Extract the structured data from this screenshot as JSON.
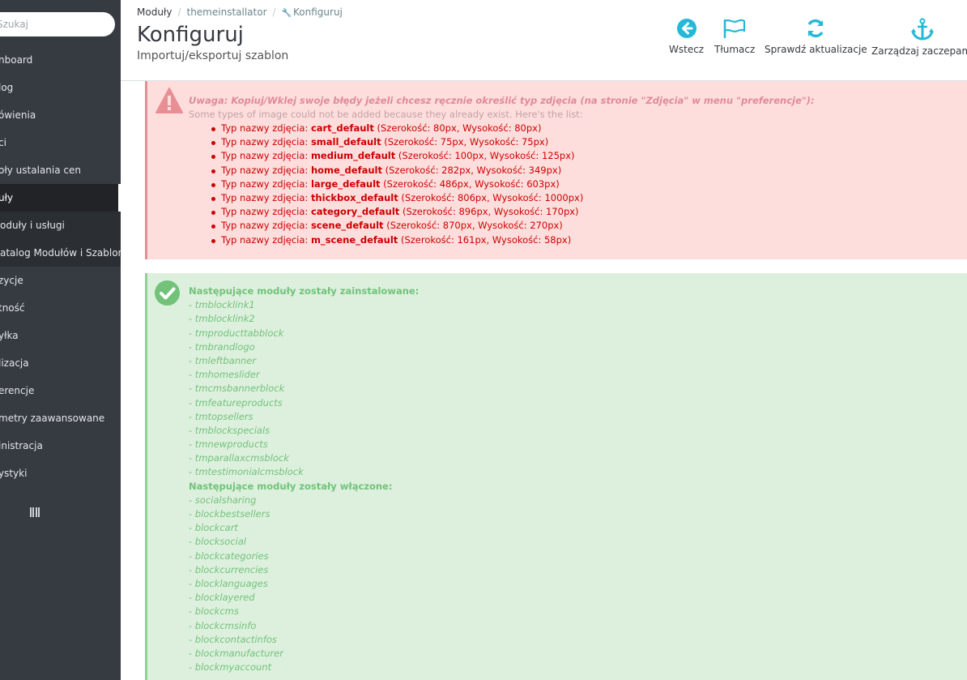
{
  "search": {
    "placeholder": "Szukaj"
  },
  "sidebar": {
    "items": [
      {
        "label": "nboard",
        "x": -2
      },
      {
        "label": "log",
        "x": -2
      },
      {
        "label": "ówienia",
        "x": -2
      },
      {
        "label": "ci",
        "x": -2
      },
      {
        "label": "oły ustalania cen",
        "x": -2
      },
      {
        "label": "uły",
        "x": -2
      },
      {
        "label": "oduły i usługi",
        "x": -2
      },
      {
        "label": "atalog Modułów i Szablon...",
        "x": -2
      },
      {
        "label": "zycje",
        "x": -2
      },
      {
        "label": "tność",
        "x": -2
      },
      {
        "label": "yłka",
        "x": -2
      },
      {
        "label": "lizacja",
        "x": -2
      },
      {
        "label": "erencje",
        "x": -2
      },
      {
        "label": "metry zaawansowane",
        "x": -2
      },
      {
        "label": "inistracja",
        "x": -2
      },
      {
        "label": "ystyki",
        "x": -2
      }
    ]
  },
  "breadcrumb": {
    "item1": "Moduły",
    "item2": "themeinstallator",
    "item3": "Konfiguruj"
  },
  "page": {
    "title": "Konfiguruj",
    "subtitle": "Importuj/eksportuj szablon"
  },
  "toolbar": {
    "back": "Wstecz",
    "translate": "Tłumacz",
    "check_updates": "Sprawdź aktualizacje",
    "manage_hooks": "Zarządzaj zaczepami"
  },
  "colors": {
    "accent": "#25b9d7",
    "danger_bg": "#fddedd",
    "success_bg": "#ddf0de",
    "sidebar_bg": "#363a41"
  },
  "warning": {
    "title": "Uwaga: Kopiuj/Wklej swoje błędy jeżeli chcesz ręcznie określić typ zdjęcia (na stronie \"Zdjęcia\" w menu \"preferencje\"):",
    "subtitle": "Some types of image could not be added because they already exist. Here's the list:",
    "prefix": "Typ nazwy zdjęcia: ",
    "items": [
      {
        "name": "cart_default",
        "dims": " (Szerokość: 80px, Wysokość: 80px)"
      },
      {
        "name": "small_default",
        "dims": " (Szerokość: 75px, Wysokość: 75px)"
      },
      {
        "name": "medium_default",
        "dims": " (Szerokość: 100px, Wysokość: 125px)"
      },
      {
        "name": "home_default",
        "dims": " (Szerokość: 282px, Wysokość: 349px)"
      },
      {
        "name": "large_default",
        "dims": " (Szerokość: 486px, Wysokość: 603px)"
      },
      {
        "name": "thickbox_default",
        "dims": " (Szerokość: 806px, Wysokość: 1000px)"
      },
      {
        "name": "category_default",
        "dims": " (Szerokość: 896px, Wysokość: 170px)"
      },
      {
        "name": "scene_default",
        "dims": " (Szerokość: 870px, Wysokość: 270px)"
      },
      {
        "name": "m_scene_default",
        "dims": " (Szerokość: 161px, Wysokość: 58px)"
      }
    ]
  },
  "success": {
    "installed_title": "Następujące moduły zostały zainstalowane:",
    "installed": [
      "- tmblocklink1",
      "- tmblocklink2",
      "- tmproducttabblock",
      "- tmbrandlogo",
      "- tmleftbanner",
      "- tmhomeslider",
      "- tmcmsbannerblock",
      "- tmfeatureproducts",
      "- tmtopsellers",
      "- tmblockspecials",
      "- tmnewproducts",
      "- tmparallaxcmsblock",
      "- tmtestimonialcmsblock"
    ],
    "enabled_title": "Następujące moduły zostały włączone:",
    "enabled": [
      "- socialsharing",
      "- blockbestsellers",
      "- blockcart",
      "- blocksocial",
      "- blockcategories",
      "- blockcurrencies",
      "- blocklanguages",
      "- blocklayered",
      "- blockcms",
      "- blockcmsinfo",
      "- blockcontactinfos",
      "- blockmanufacturer",
      "- blockmyaccount"
    ]
  }
}
